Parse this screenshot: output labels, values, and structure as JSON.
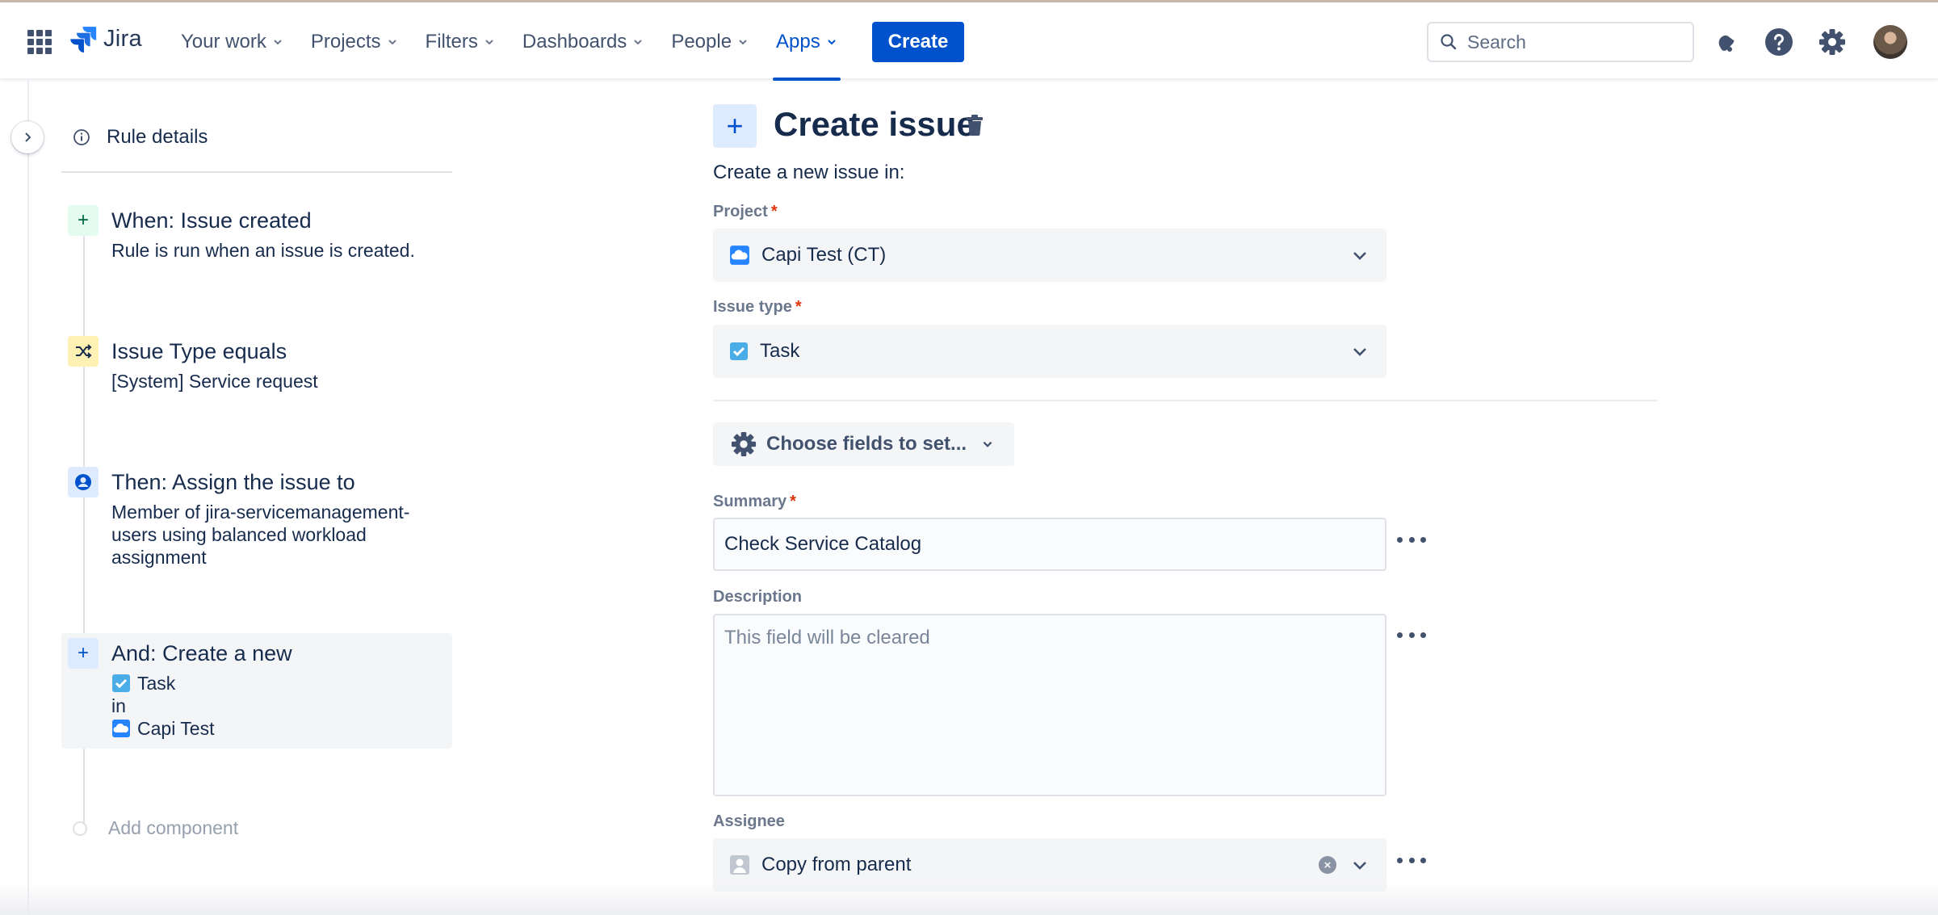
{
  "topbar": {
    "brand": "Jira",
    "nav": [
      {
        "label": "Your work"
      },
      {
        "label": "Projects"
      },
      {
        "label": "Filters"
      },
      {
        "label": "Dashboards"
      },
      {
        "label": "People"
      },
      {
        "label": "Apps",
        "active": true
      }
    ],
    "create_label": "Create",
    "search_placeholder": "Search",
    "icons": [
      "app-switcher-icon",
      "notifications-icon",
      "help-icon",
      "settings-icon",
      "avatar"
    ],
    "accent_color": "#0052cc"
  },
  "sidebar": {
    "rule_details_label": "Rule details",
    "steps": [
      {
        "title": "When: Issue created",
        "desc": "Rule is run when an issue is created.",
        "icon": "plus-icon"
      },
      {
        "title": "Issue Type equals",
        "desc": "[System] Service request",
        "icon": "shuffle-icon"
      },
      {
        "title": "Then: Assign the issue to",
        "desc": "Member of jira-servicemanagement-users using balanced workload assignment",
        "icon": "user-circle-icon"
      },
      {
        "title": "And: Create a new",
        "line1": "Task",
        "line2": "in",
        "line3": "Capi Test",
        "icon": "plus-icon",
        "selected": true
      }
    ],
    "add_component_label": "Add component"
  },
  "form": {
    "title": "Create issue",
    "subtitle": "Create a new issue in:",
    "project_label": "Project",
    "project_value": "Capi Test (CT)",
    "issuetype_label": "Issue type",
    "issuetype_value": "Task",
    "choose_fields_label": "Choose fields to set...",
    "summary_label": "Summary",
    "summary_value": "Check Service Catalog",
    "description_label": "Description",
    "description_placeholder": "This field will be cleared",
    "assignee_label": "Assignee",
    "assignee_value": "Copy from parent",
    "required_mark": "*"
  }
}
